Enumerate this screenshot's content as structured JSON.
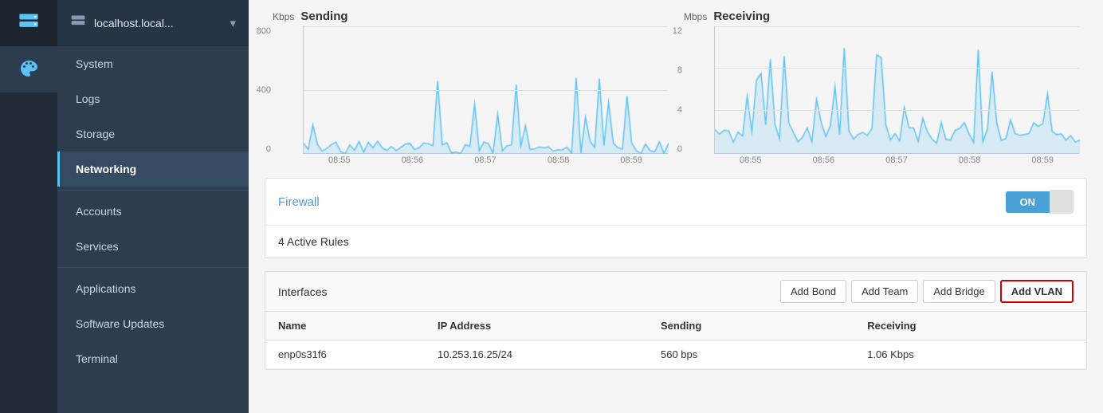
{
  "icon_rail": {
    "server_icon": "server",
    "palette_icon": "palette"
  },
  "nav_header": {
    "title": "localhost.local...",
    "icon": "server-icon"
  },
  "nav_items": [
    {
      "id": "system",
      "label": "System",
      "active": false
    },
    {
      "id": "logs",
      "label": "Logs",
      "active": false
    },
    {
      "id": "storage",
      "label": "Storage",
      "active": false
    },
    {
      "id": "networking",
      "label": "Networking",
      "active": true
    },
    {
      "id": "accounts",
      "label": "Accounts",
      "active": false
    },
    {
      "id": "services",
      "label": "Services",
      "active": false
    },
    {
      "id": "applications",
      "label": "Applications",
      "active": false
    },
    {
      "id": "software-updates",
      "label": "Software Updates",
      "active": false
    },
    {
      "id": "terminal",
      "label": "Terminal",
      "active": false
    }
  ],
  "charts": {
    "sending": {
      "unit": "Kbps",
      "title": "Sending",
      "y_labels": [
        "800",
        "400",
        "0"
      ],
      "x_labels": [
        "08:55",
        "08:56",
        "08:57",
        "08:58",
        "08:59"
      ]
    },
    "receiving": {
      "unit": "Mbps",
      "title": "Receiving",
      "y_labels": [
        "12",
        "8",
        "4",
        "0"
      ],
      "x_labels": [
        "08:55",
        "08:56",
        "08:57",
        "08:58",
        "08:59"
      ]
    }
  },
  "firewall": {
    "link_label": "Firewall",
    "toggle_label": "ON",
    "rules_text": "4 Active Rules"
  },
  "interfaces": {
    "title": "Interfaces",
    "buttons": {
      "add_bond": "Add Bond",
      "add_team": "Add Team",
      "add_bridge": "Add Bridge",
      "add_vlan": "Add VLAN"
    },
    "columns": [
      "Name",
      "IP Address",
      "Sending",
      "Receiving"
    ],
    "rows": [
      {
        "name": "enp0s31f6",
        "ip_address": "10.253.16.25/24",
        "sending": "560 bps",
        "receiving": "1.06 Kbps"
      }
    ]
  }
}
